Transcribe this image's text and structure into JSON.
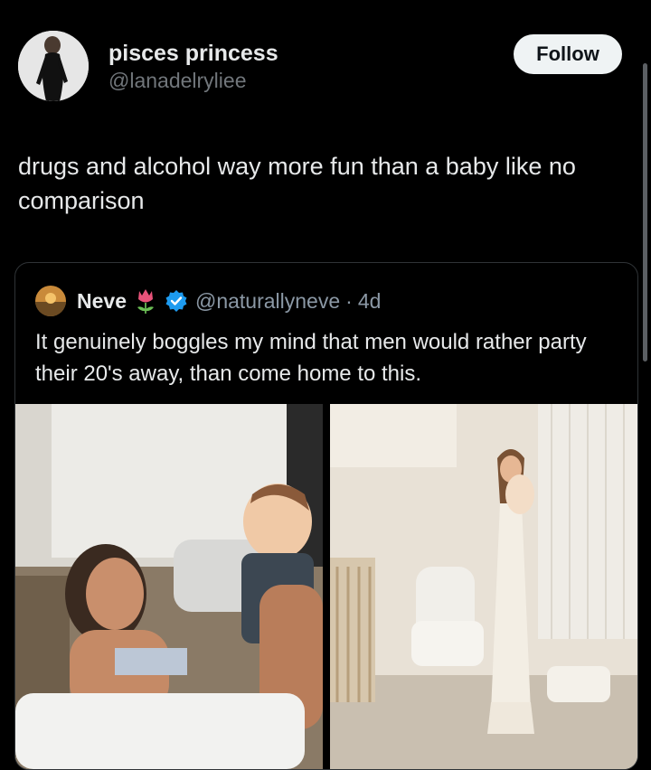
{
  "post": {
    "author": {
      "display_name": "pisces princess",
      "handle": "@lanadelryliee",
      "avatar_icon": "profile-photo"
    },
    "follow_label": "Follow",
    "text": "drugs and alcohol way more fun than a baby like no comparison"
  },
  "quoted_post": {
    "author": {
      "display_name": "Neve",
      "emoji_icon": "tulip-icon",
      "verified_icon": "verified-badge-icon",
      "handle": "@naturallyneve",
      "separator": "·",
      "time": "4d"
    },
    "text": "It genuinely boggles my mind that men would rather party their 20's away, than come home to this.",
    "media": [
      {
        "icon": "photo-woman-lying-with-baby"
      },
      {
        "icon": "photo-woman-holding-baby-in-nursery"
      }
    ]
  },
  "colors": {
    "background": "#000000",
    "text": "#e7e9ea",
    "secondary_text": "#71767b",
    "border": "#2f3336",
    "follow_button": "#eff3f4",
    "verified": "#1d9bf0"
  }
}
